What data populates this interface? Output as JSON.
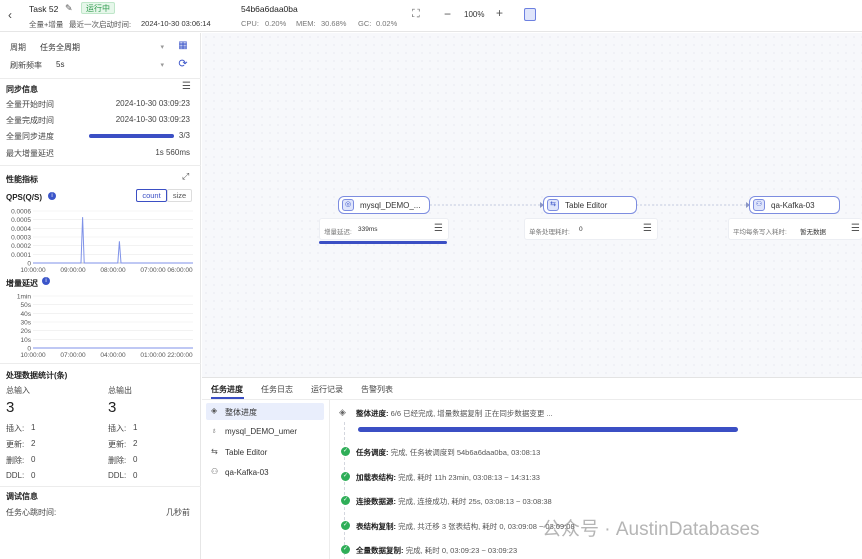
{
  "header": {
    "task_name": "Task 52",
    "status": "运行中",
    "subtitle_mode": "全量+增量",
    "last_start_label": "最近一次启动时间:",
    "last_start_time": "2024-10-30 03:06:14",
    "task_id": "54b6a6daa0ba",
    "cpu_label": "CPU:",
    "cpu_value": "0.20%",
    "mem_label": "MEM:",
    "mem_value": "30.68%",
    "gc_label": "GC:",
    "gc_value": "0.02%",
    "zoom": "100%",
    "minus": "−",
    "plus": "+"
  },
  "filters": {
    "period_label": "周期",
    "period_value": "任务全周期",
    "refresh_label": "刷新频率",
    "refresh_value": "5s"
  },
  "sync_info": {
    "title": "同步信息",
    "full_start_label": "全量开始时间",
    "full_start_value": "2024-10-30 03:09:23",
    "full_done_label": "全量完成时间",
    "full_done_value": "2024-10-30 03:09:23",
    "full_progress_label": "全量同步进度",
    "full_progress_value": "3/3",
    "full_progress_fraction": 1.0,
    "max_delay_label": "最大增量延迟",
    "max_delay_value": "1s 560ms"
  },
  "metrics": {
    "title": "性能指标",
    "qps_label": "QPS(Q/S)",
    "btn_count": "count",
    "btn_size": "size",
    "delay_label": "增量延迟"
  },
  "chart_data": [
    {
      "type": "line",
      "title": "QPS(Q/S)",
      "x_ticks": [
        "10:00:00",
        "09:00:00",
        "08:00:00",
        "07:00:00",
        "06:00:00"
      ],
      "y_ticks": [
        "0.0006",
        "0.0005",
        "0.0004",
        "0.0003",
        "0.0002",
        "0.0001",
        "0"
      ],
      "ylim": [
        0,
        0.0006
      ],
      "grid": true,
      "series": [
        {
          "x": [
            0,
            0.3,
            0.31,
            0.32,
            0.53,
            0.54,
            0.55,
            1
          ],
          "values": [
            0,
            0,
            0.00053,
            0,
            0,
            0.00025,
            0,
            0
          ]
        }
      ]
    },
    {
      "type": "line",
      "title": "增量延迟",
      "x_ticks": [
        "10:00:00",
        "07:00:00",
        "04:00:00",
        "01:00:00",
        "22:00:00"
      ],
      "y_ticks": [
        "1min",
        "50s",
        "40s",
        "30s",
        "20s",
        "10s",
        "0"
      ],
      "ylim": [
        0,
        60
      ],
      "grid": true,
      "series": [
        {
          "x": [
            0,
            1
          ],
          "values": [
            0,
            0
          ]
        }
      ]
    }
  ],
  "stats": {
    "title": "处理数据统计(条)",
    "total_in_label": "总输入",
    "total_in_value": "3",
    "total_out_label": "总输出",
    "total_out_value": "3",
    "in_rows": [
      {
        "label": "插入:",
        "value": "1"
      },
      {
        "label": "更新:",
        "value": "2"
      },
      {
        "label": "删除:",
        "value": "0"
      },
      {
        "label": "DDL:",
        "value": "0"
      }
    ],
    "out_rows": [
      {
        "label": "插入:",
        "value": "1"
      },
      {
        "label": "更新:",
        "value": "2"
      },
      {
        "label": "删除:",
        "value": "0"
      },
      {
        "label": "DDL:",
        "value": "0"
      }
    ]
  },
  "debug": {
    "title": "调试信息",
    "heartbeat_label": "任务心跳时间:",
    "heartbeat_value": "几秒前"
  },
  "canvas": {
    "nodes": [
      {
        "label": "mysql_DEMO_..."
      },
      {
        "label": "Table Editor"
      },
      {
        "label": "qa-Kafka-03"
      }
    ],
    "cards": [
      {
        "label": "增量延迟:",
        "value": "339ms"
      },
      {
        "label": "单条处理耗时:",
        "value": "0"
      },
      {
        "label": "平均每条写入耗时:",
        "value": "暂无数据"
      }
    ]
  },
  "bottom": {
    "tabs": [
      "任务进度",
      "任务日志",
      "运行记录",
      "告警列表"
    ],
    "nav": [
      {
        "label": "整体进度"
      },
      {
        "label": "mysql_DEMO_umer"
      },
      {
        "label": "Table Editor"
      },
      {
        "label": "qa-Kafka-03"
      }
    ],
    "overall": {
      "title": "整体进度:",
      "text": "6/6 已经完成, 增量数据复制 正在同步数据变更 ...",
      "fraction": 1.0
    },
    "steps": [
      {
        "title": "任务调度:",
        "text": "完成, 任务被调度到 54b6a6daa0ba, 03:08:13"
      },
      {
        "title": "加载表结构:",
        "text": "完成, 耗时 11h 23min, 03:08:13 ~ 14:31:33"
      },
      {
        "title": "连接数据源:",
        "text": "完成, 连接成功, 耗时 25s, 03:08:13 ~ 03:08:38"
      },
      {
        "title": "表结构复制:",
        "text": "完成, 共迁移 3 张表结构, 耗时 0, 03:09:08 ~ 03:09:08"
      },
      {
        "title": "全量数据复制:",
        "text": "完成, 耗时 0, 03:09:23 ~ 03:09:23"
      }
    ],
    "watermark": "公众号 · AustinDatabases"
  },
  "colors": {
    "accent": "#3b4fc4",
    "success": "#2fae58",
    "chart_line": "#7f92e8"
  }
}
